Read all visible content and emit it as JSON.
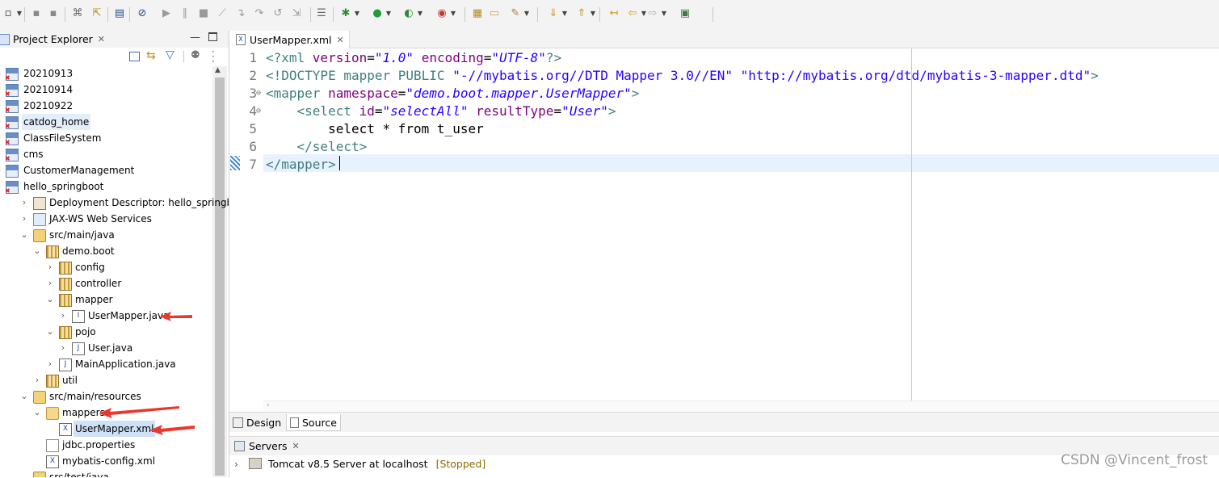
{
  "toolbar": {
    "icons": [
      "new-icon",
      "save-icon",
      "save-all-icon",
      "open-type-icon",
      "open-resource-icon",
      "terminal-icon",
      "skip-breakpoints-icon",
      "resume-icon",
      "suspend-icon",
      "terminate-icon",
      "disconnect-icon",
      "step-into-icon",
      "step-over-icon",
      "step-return-icon",
      "drop-to-frame-icon",
      "use-step-filters-icon",
      "debug-icon",
      "run-icon",
      "coverage-icon",
      "run-external-icon",
      "new-java-project-icon",
      "open-folder-icon",
      "build-icon",
      "next-annotation-icon",
      "previous-annotation-icon",
      "last-edit-icon",
      "back-icon",
      "forward-icon",
      "pin-editor-icon"
    ]
  },
  "explorer": {
    "title": "Project Explorer",
    "rows": [
      {
        "label": "20210913",
        "depth": 0,
        "twisty": "",
        "icon": "project-error-icon"
      },
      {
        "label": "20210914",
        "depth": 0,
        "twisty": "",
        "icon": "project-error-icon"
      },
      {
        "label": "20210922",
        "depth": 0,
        "twisty": "",
        "icon": "project-error-icon"
      },
      {
        "label": "catdog_home",
        "depth": 0,
        "twisty": "",
        "icon": "project-error-icon",
        "selected": true
      },
      {
        "label": "ClassFileSystem",
        "depth": 0,
        "twisty": "",
        "icon": "project-error-icon"
      },
      {
        "label": "cms",
        "depth": 0,
        "twisty": "",
        "icon": "project-error-icon"
      },
      {
        "label": "CustomerManagement",
        "depth": 0,
        "twisty": "",
        "icon": "project-icon"
      },
      {
        "label": "hello_springboot",
        "depth": 0,
        "twisty": "",
        "icon": "project-error-icon"
      },
      {
        "label": "Deployment Descriptor: hello_springb",
        "depth": 1,
        "twisty": "›",
        "icon": "deployment-descriptor-icon"
      },
      {
        "label": "JAX-WS Web Services",
        "depth": 1,
        "twisty": "›",
        "icon": "web-services-icon"
      },
      {
        "label": "src/main/java",
        "depth": 1,
        "twisty": "⌄",
        "icon": "source-folder-icon"
      },
      {
        "label": "demo.boot",
        "depth": 2,
        "twisty": "⌄",
        "icon": "package-icon"
      },
      {
        "label": "config",
        "depth": 3,
        "twisty": "›",
        "icon": "package-icon"
      },
      {
        "label": "controller",
        "depth": 3,
        "twisty": "›",
        "icon": "package-icon"
      },
      {
        "label": "mapper",
        "depth": 3,
        "twisty": "⌄",
        "icon": "package-icon"
      },
      {
        "label": "UserMapper.java",
        "depth": 4,
        "twisty": "›",
        "icon": "java-interface-icon"
      },
      {
        "label": "pojo",
        "depth": 3,
        "twisty": "⌄",
        "icon": "package-icon"
      },
      {
        "label": "User.java",
        "depth": 4,
        "twisty": "›",
        "icon": "java-file-icon"
      },
      {
        "label": "MainApplication.java",
        "depth": 3,
        "twisty": "›",
        "icon": "java-file-icon"
      },
      {
        "label": "util",
        "depth": 2,
        "twisty": "›",
        "icon": "package-icon"
      },
      {
        "label": "src/main/resources",
        "depth": 1,
        "twisty": "⌄",
        "icon": "source-folder-icon"
      },
      {
        "label": "mappers",
        "depth": 2,
        "twisty": "⌄",
        "icon": "folder-icon"
      },
      {
        "label": "UserMapper.xml",
        "depth": 3,
        "twisty": "",
        "icon": "xml-file-icon",
        "selected": true
      },
      {
        "label": "jdbc.properties",
        "depth": 2,
        "twisty": "",
        "icon": "properties-file-icon"
      },
      {
        "label": "mybatis-config.xml",
        "depth": 2,
        "twisty": "",
        "icon": "xml-file-icon"
      },
      {
        "label": "src/test/java",
        "depth": 1,
        "twisty": "",
        "icon": "source-folder-icon"
      }
    ]
  },
  "editor": {
    "tab_label": "UserMapper.xml",
    "line_numbers": [
      "1",
      "2",
      "3",
      "4",
      "5",
      "6",
      "7"
    ],
    "line_markers": [
      "",
      "",
      "⊖",
      "⊖",
      "",
      "",
      ""
    ],
    "lines": [
      [
        {
          "c": "t-tag",
          "t": "<?xml "
        },
        {
          "c": "t-attr",
          "t": "version"
        },
        {
          "c": "t-txt",
          "t": "="
        },
        {
          "c": "t-val",
          "t": "\"1.0\""
        },
        {
          "c": "t-txt",
          "t": " "
        },
        {
          "c": "t-attr",
          "t": "encoding"
        },
        {
          "c": "t-txt",
          "t": "="
        },
        {
          "c": "t-val",
          "t": "\"UTF-8\""
        },
        {
          "c": "t-tag",
          "t": "?>"
        }
      ],
      [
        {
          "c": "t-tag",
          "t": "<!DOCTYPE mapper "
        },
        {
          "c": "t-tag",
          "t": "PUBLIC "
        },
        {
          "c": "t-str",
          "t": "\"-//mybatis.org//DTD Mapper 3.0//EN\""
        },
        {
          "c": "t-txt",
          "t": " "
        },
        {
          "c": "t-str",
          "t": "\"http://mybatis.org/dtd/mybatis-3-mapper.dtd\""
        },
        {
          "c": "t-tag",
          "t": ">"
        }
      ],
      [
        {
          "c": "t-tag",
          "t": "<mapper "
        },
        {
          "c": "t-attr",
          "t": "namespace"
        },
        {
          "c": "t-txt",
          "t": "="
        },
        {
          "c": "t-val",
          "t": "\"demo.boot.mapper.UserMapper\""
        },
        {
          "c": "t-tag",
          "t": ">"
        }
      ],
      [
        {
          "c": "t-txt",
          "t": "    "
        },
        {
          "c": "t-tag",
          "t": "<select "
        },
        {
          "c": "t-attr",
          "t": "id"
        },
        {
          "c": "t-txt",
          "t": "="
        },
        {
          "c": "t-val",
          "t": "\"selectAll\""
        },
        {
          "c": "t-txt",
          "t": " "
        },
        {
          "c": "t-attr",
          "t": "resultType"
        },
        {
          "c": "t-txt",
          "t": "="
        },
        {
          "c": "t-val",
          "t": "\"User\""
        },
        {
          "c": "t-tag",
          "t": ">"
        }
      ],
      [
        {
          "c": "t-txt",
          "t": "        select * from t_user"
        }
      ],
      [
        {
          "c": "t-txt",
          "t": "    "
        },
        {
          "c": "t-tag",
          "t": "</select>"
        }
      ],
      [
        {
          "c": "t-tag",
          "t": "</mapper>"
        }
      ]
    ]
  },
  "bottom_tabs": {
    "design": "Design",
    "source": "Source"
  },
  "servers": {
    "title": "Servers",
    "row_label": "Tomcat v8.5 Server at localhost",
    "row_status": "[Stopped]"
  },
  "watermark": "CSDN @Vincent_frost",
  "colors": {
    "tag": "#3f7f7f",
    "attr": "#7f007f",
    "value": "#2a00ff",
    "annotation_arrow": "#e8392f",
    "current_line": "#e8f2fe"
  }
}
